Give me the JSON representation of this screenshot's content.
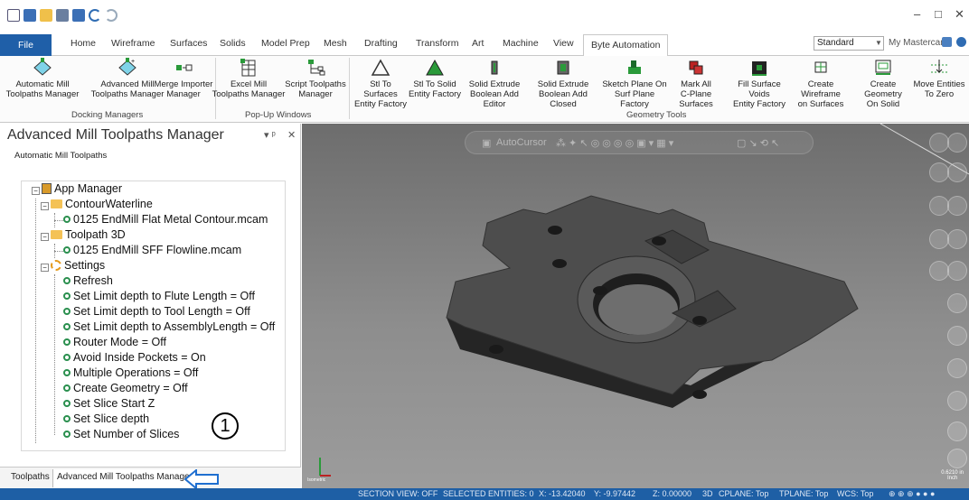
{
  "window": {
    "minimize_glyph": "–",
    "maximize_glyph": "□",
    "close_glyph": "✕"
  },
  "tabs": {
    "file": "File",
    "home": "Home",
    "wireframe": "Wireframe",
    "surfaces": "Surfaces",
    "solids": "Solids",
    "model_prep": "Model Prep",
    "mesh": "Mesh",
    "drafting": "Drafting",
    "transform": "Transform",
    "art": "Art",
    "machine": "Machine",
    "view": "View",
    "byte_automation": "Byte Automation"
  },
  "workspace": {
    "selected": "Standard",
    "my_mastercam": "My Mastercam"
  },
  "ribbon": {
    "auto_mill": [
      "Automatic Mill",
      "Toolpaths Manager"
    ],
    "adv_mill": [
      "Advanced Mill",
      "Toolpaths Manager"
    ],
    "merge_importer": [
      "Merge Importer",
      "Manager"
    ],
    "excel_mill": [
      "Excel Mill",
      "Toolpaths Manager"
    ],
    "script_toolpaths": [
      "Script Toolpaths",
      "Manager"
    ],
    "stl_surfaces": [
      "Stl To Surfaces",
      "Entity Factory"
    ],
    "stl_solid": [
      "Stl To Solid",
      "Entity Factory"
    ],
    "solid_extrude_editor": [
      "Solid Extrude",
      "Boolean Add Editor"
    ],
    "solid_extrude_closed": [
      "Solid Extrude",
      "Boolean Add Closed"
    ],
    "sketch_plane": [
      "Sketch Plane On",
      "Surf Plane Factory"
    ],
    "mark_all": [
      "Mark All",
      "C-Plane Surfaces"
    ],
    "fill_voids": [
      "Fill Surface Voids",
      "Entity Factory"
    ],
    "create_wireframe": [
      "Create Wireframe",
      "on Surfaces"
    ],
    "create_geometry": [
      "Create Geometry",
      "On Solid"
    ],
    "move_entities": [
      "Move Entities",
      "To Zero"
    ],
    "group_docking": "Docking Managers",
    "group_popup": "Pop-Up Windows",
    "group_geometry": "Geometry Tools"
  },
  "panel": {
    "title": "Advanced Mill Toolpaths Manager",
    "pin_glyph": "▾ ᵖ",
    "close_glyph": "✕",
    "subtitle": "Automatic Mill Toolpaths",
    "tree": {
      "root": "App Manager",
      "folder1": "ContourWaterline",
      "file1": "0125 EndMill Flat Metal Contour.mcam",
      "folder2": "Toolpath 3D",
      "file2": "0125 EndMill SFF Flowline.mcam",
      "settings": "Settings",
      "items": [
        "Refresh",
        "Set Limit depth to Flute Length = Off",
        "Set Limit depth to Tool Length = Off",
        "Set Limit depth to AssemblyLength = Off",
        "Router Mode = Off",
        "Avoid Inside Pockets = On",
        "Multiple Operations = Off",
        "Create Geometry = Off",
        "Set Slice Start Z",
        "Set Slice depth",
        "Set Number of Slices"
      ]
    },
    "callout": "1",
    "bottom_tabs": [
      "Toolpaths",
      "Advanced Mill Toolpaths Manager"
    ]
  },
  "viewport": {
    "autocursor": "AutoCursor",
    "view_label": "Isometric",
    "scale_value": "0.6210 in",
    "scale_unit": "Inch"
  },
  "status": {
    "section_view": "SECTION VIEW: OFF",
    "selected": "SELECTED ENTITIES: 0",
    "x": "X:  -13.42040",
    "y": "Y:  -9.97442",
    "z": "Z:  0.00000",
    "mode": "3D",
    "cplane": "CPLANE: Top",
    "tplane": "TPLANE: Top",
    "wcs": "WCS: Top"
  },
  "colors": {
    "accent": "#1f5fa8",
    "statusbar": "#1e5fa5",
    "tree_bullet": "#2a8f4e",
    "folder": "#f4c256"
  }
}
